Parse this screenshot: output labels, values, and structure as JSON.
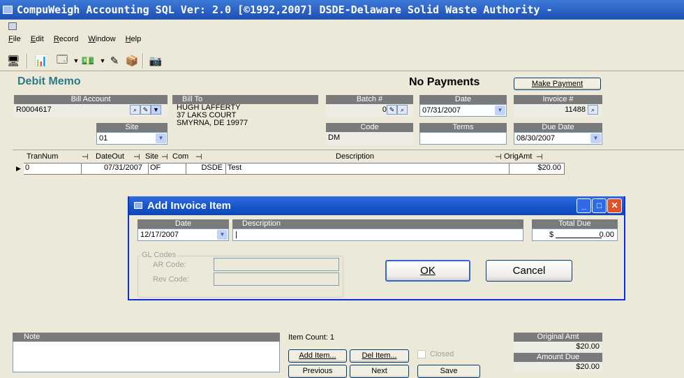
{
  "window": {
    "title": "CompuWeigh Accounting SQL Ver: 2.0 [©1992,2007]  DSDE-Delaware Solid Waste Authority -"
  },
  "menu": [
    "File",
    "Edit",
    "Record",
    "Window",
    "Help"
  ],
  "toolbar_icons": [
    "open-record-icon",
    "report-icon",
    "window-dropdown-icon",
    "money-dropdown-icon",
    "post-icon",
    "box-icon",
    "camera-icon"
  ],
  "form": {
    "title": "Debit Memo",
    "payment_status": "No Payments",
    "make_payment_label": "Make Payment",
    "bill_account": {
      "label": "Bill Account",
      "value": "R0004617"
    },
    "bill_to": {
      "label": "Bill To",
      "lines": [
        "HUGH LAFFERTY",
        "37 LAKS COURT",
        "SMYRNA, DE 19977"
      ]
    },
    "site": {
      "label": "Site",
      "value": "01"
    },
    "batch": {
      "label": "Batch #",
      "value": "0"
    },
    "code": {
      "label": "Code",
      "value": "DM"
    },
    "date": {
      "label": "Date",
      "value": "07/31/2007"
    },
    "terms": {
      "label": "Terms",
      "value": ""
    },
    "invoice": {
      "label": "Invoice #",
      "value": "11488"
    },
    "due_date": {
      "label": "Due Date",
      "value": "08/30/2007"
    }
  },
  "grid": {
    "columns": [
      "TranNum",
      "DateOut",
      "Site",
      "Com",
      "Description",
      "OrigAmt"
    ],
    "rows": [
      {
        "TranNum": "0",
        "DateOut": "07/31/2007",
        "Site": "OF",
        "Com": "DSDE",
        "Description": "Test",
        "OrigAmt": "$20.00"
      }
    ]
  },
  "dialog": {
    "title": "Add Invoice Item",
    "date_label": "Date",
    "date_value": "12/17/2007",
    "description_label": "Description",
    "description_value": "|",
    "total_due_label": "Total Due",
    "total_due_currency": "$",
    "total_due_value": "0.00",
    "gl_codes_label": "GL Codes",
    "ar_code_label": "AR Code:",
    "rev_code_label": "Rev Code:",
    "ok_label": "OK",
    "cancel_label": "Cancel"
  },
  "footer": {
    "note_label": "Note",
    "item_count": "Item Count: 1",
    "add_item_label": "Add Item...",
    "del_item_label": "Del Item...",
    "closed_label": "Closed",
    "previous_label": "Previous",
    "next_label": "Next",
    "save_label": "Save",
    "original_amt_label": "Original Amt",
    "original_amt_value": "$20.00",
    "amount_due_label": "Amount Due",
    "amount_due_value": "$20.00"
  }
}
